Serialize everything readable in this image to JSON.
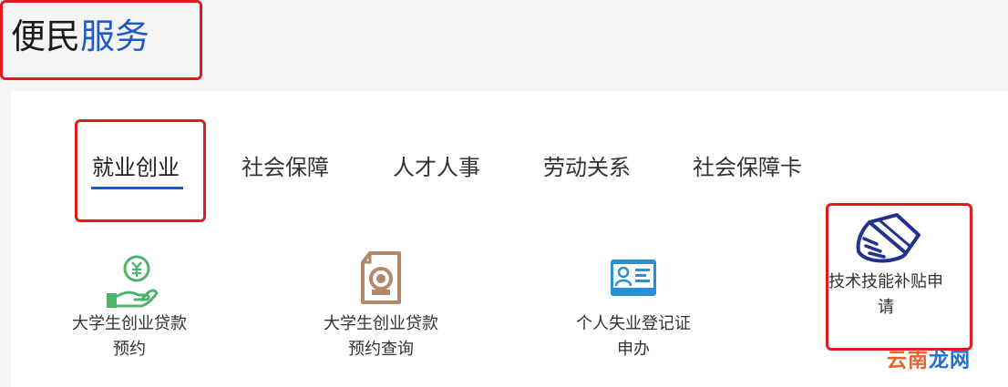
{
  "header": {
    "title_part1": "便民",
    "title_part2": "服务"
  },
  "tabs": [
    {
      "label": "就业创业",
      "active": true
    },
    {
      "label": "社会保障",
      "active": false
    },
    {
      "label": "人才人事",
      "active": false
    },
    {
      "label": "劳动关系",
      "active": false
    },
    {
      "label": "社会保障卡",
      "active": false
    }
  ],
  "services": [
    {
      "line1": "大学生创业贷款",
      "line2": "预约",
      "icon": "yuan-hand-icon"
    },
    {
      "line1": "大学生创业贷款",
      "line2": "预约查询",
      "icon": "document-search-icon"
    },
    {
      "line1": "个人失业登记证",
      "line2": "申办",
      "icon": "id-card-icon"
    },
    {
      "line1": "技术技能补贴申",
      "line2": "请",
      "icon": "hand-card-icon"
    }
  ],
  "watermark": {
    "part1": "云南",
    "part2": "龙网"
  },
  "colors": {
    "accent_blue": "#1e5bc6",
    "highlight_red": "#e11b1b",
    "icon_green": "#4fb36b",
    "icon_brown": "#b3876a",
    "icon_blue": "#2a8fd8",
    "icon_navy": "#23308d"
  }
}
